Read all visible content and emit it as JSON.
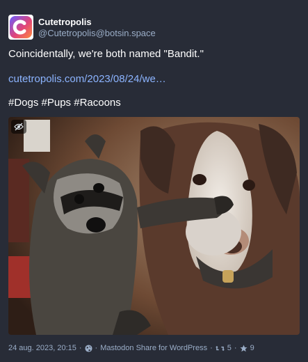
{
  "account": {
    "display_name": "Cutetropolis",
    "handle": "@Cutetropolis@botsin.space",
    "avatar_icon": "cutetropolis-logo"
  },
  "post": {
    "text": "Coincidentally, we're both named \"Bandit.\"",
    "link": "cutetropolis.com/2023/08/24/we…",
    "hashtags": "#Dogs #Pups #Racoons"
  },
  "media": {
    "sensitive_toggle_icon": "eye-slash-icon",
    "alt_description": "photo of a raccoon next to a dog"
  },
  "footer": {
    "timestamp": "24 aug. 2023, 20:15",
    "separator": "·",
    "visibility_icon": "globe-icon",
    "application": "Mastodon Share for WordPress",
    "boost_icon": "retweet-icon",
    "boost_count": "5",
    "favourite_icon": "star-icon",
    "favourite_count": "9"
  },
  "colors": {
    "background": "#282c37",
    "link": "#8c8dff",
    "muted": "#9baec8"
  }
}
